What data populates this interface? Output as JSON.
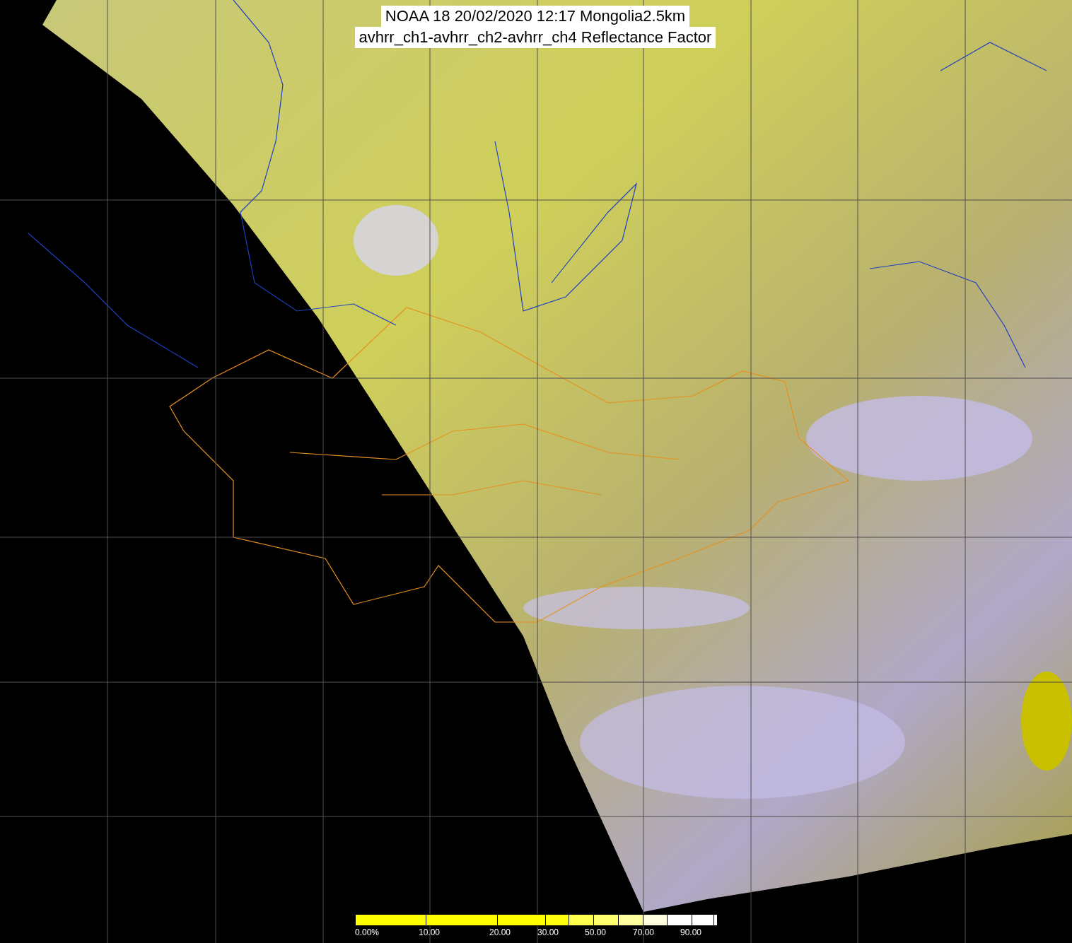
{
  "title": {
    "lines": [
      "NOAA 18 20/02/2020 12:17 Mongolia2.5km",
      "avhrr_ch1-avhrr_ch2-avhrr_ch4 Reflectance Factor"
    ]
  },
  "colorbar": {
    "segments": [
      {
        "color": "#ffff00"
      },
      {
        "color": "#ffff00"
      },
      {
        "color": "#ffff00"
      },
      {
        "color": "#ffff10"
      },
      {
        "color": "#ffff50"
      },
      {
        "color": "#ffff70"
      },
      {
        "color": "#ffffa0"
      },
      {
        "color": "#ffffe0"
      },
      {
        "color": "#ffffff"
      },
      {
        "color": "#ffffff"
      },
      {
        "color": "#ffffff"
      }
    ],
    "labels": [
      "0.00%",
      "10.00",
      "20.00",
      "30.00",
      "50.00",
      "70.00",
      "90.00"
    ]
  }
}
